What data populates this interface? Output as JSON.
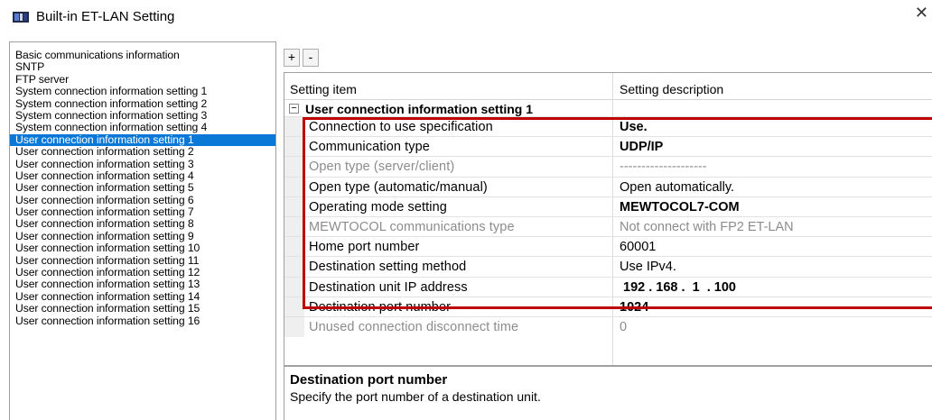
{
  "window": {
    "title": "Built-in ET-LAN Setting",
    "close": "✕"
  },
  "toolbar": {
    "expand": "+",
    "collapse": "-"
  },
  "sidebar": {
    "items": [
      "Basic communications information",
      "SNTP",
      "FTP server",
      "System connection information setting 1",
      "System connection information setting 2",
      "System connection information setting 3",
      "System connection information setting 4",
      "User connection information setting 1",
      "User connection information setting 2",
      "User connection information setting 3",
      "User connection information setting 4",
      "User connection information setting 5",
      "User connection information setting 6",
      "User connection information setting 7",
      "User connection information setting 8",
      "User connection information setting 9",
      "User connection information setting 10",
      "User connection information setting 11",
      "User connection information setting 12",
      "User connection information setting 13",
      "User connection information setting 14",
      "User connection information setting 15",
      "User connection information setting 16"
    ],
    "selected_index": 7
  },
  "grid": {
    "headers": {
      "item": "Setting item",
      "description": "Setting description"
    },
    "group": {
      "toggle": "−",
      "label": "User connection information setting 1"
    },
    "rows": [
      {
        "item": "Connection to use specification",
        "value": "Use.",
        "bold": true,
        "enabled": true
      },
      {
        "item": "Communication type",
        "value": "UDP/IP",
        "bold": true,
        "enabled": true
      },
      {
        "item": "Open type (server/client)",
        "value": "--------------------",
        "bold": false,
        "enabled": false
      },
      {
        "item": "Open type (automatic/manual)",
        "value": "Open automatically.",
        "bold": false,
        "enabled": true
      },
      {
        "item": "Operating mode setting",
        "value": "MEWTOCOL7-COM",
        "bold": true,
        "enabled": true
      },
      {
        "item": "MEWTOCOL communications type",
        "value": "Not connect with FP2 ET-LAN",
        "bold": false,
        "enabled": false
      },
      {
        "item": "Home port number",
        "value": "60001",
        "bold": false,
        "enabled": true
      },
      {
        "item": "Destination setting method",
        "value": "Use IPv4.",
        "bold": false,
        "enabled": true
      },
      {
        "item": "Destination unit IP address",
        "value": " 192 . 168 .  1  . 100",
        "bold": true,
        "enabled": true
      },
      {
        "item": "Destination port number",
        "value": "1024",
        "bold": true,
        "enabled": true
      },
      {
        "item": "Unused connection disconnect time",
        "value": "0",
        "bold": false,
        "enabled": false
      }
    ]
  },
  "description": {
    "title": "Destination port number",
    "text": "Specify the port number of a destination unit."
  },
  "colors": {
    "selection": "#0a78d7",
    "highlight_box": "#c00000",
    "disabled_text": "#8c8c8c"
  }
}
